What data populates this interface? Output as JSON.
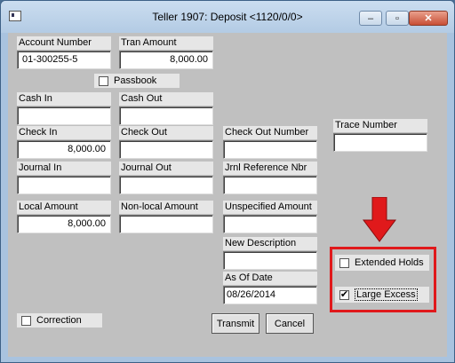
{
  "window": {
    "title": "Teller 1907: Deposit <1120/0/0>",
    "minimize": "–",
    "maximize": "▫",
    "close": "✕"
  },
  "fields": {
    "account_number": {
      "label": "Account Number",
      "value": "01-300255-5"
    },
    "tran_amount": {
      "label": "Tran Amount",
      "value": "8,000.00"
    },
    "cash_in": {
      "label": "Cash In",
      "value": ""
    },
    "cash_out": {
      "label": "Cash Out",
      "value": ""
    },
    "check_in": {
      "label": "Check In",
      "value": "8,000.00"
    },
    "check_out": {
      "label": "Check Out",
      "value": ""
    },
    "check_out_number": {
      "label": "Check Out Number",
      "value": ""
    },
    "trace_number": {
      "label": "Trace Number",
      "value": ""
    },
    "journal_in": {
      "label": "Journal In",
      "value": ""
    },
    "journal_out": {
      "label": "Journal Out",
      "value": ""
    },
    "jrnl_reference_nbr": {
      "label": "Jrnl Reference Nbr",
      "value": ""
    },
    "local_amount": {
      "label": "Local Amount",
      "value": "8,000.00"
    },
    "nonlocal_amount": {
      "label": "Non-local Amount",
      "value": ""
    },
    "unspecified_amount": {
      "label": "Unspecified Amount",
      "value": ""
    },
    "new_description": {
      "label": "New Description",
      "value": ""
    },
    "as_of_date": {
      "label": "As Of Date",
      "value": "08/26/2014"
    }
  },
  "checkboxes": {
    "passbook": {
      "label": "Passbook",
      "checked": false
    },
    "extended_holds": {
      "label": "Extended Holds",
      "checked": false
    },
    "large_excess": {
      "label": "Large Excess",
      "checked": true
    },
    "correction": {
      "label": "Correction",
      "checked": false
    }
  },
  "buttons": {
    "transmit": "Transmit",
    "cancel": "Cancel"
  },
  "colors": {
    "highlight": "#e0191b",
    "form_background": "#c0c0c0"
  },
  "checkmark": "✔"
}
